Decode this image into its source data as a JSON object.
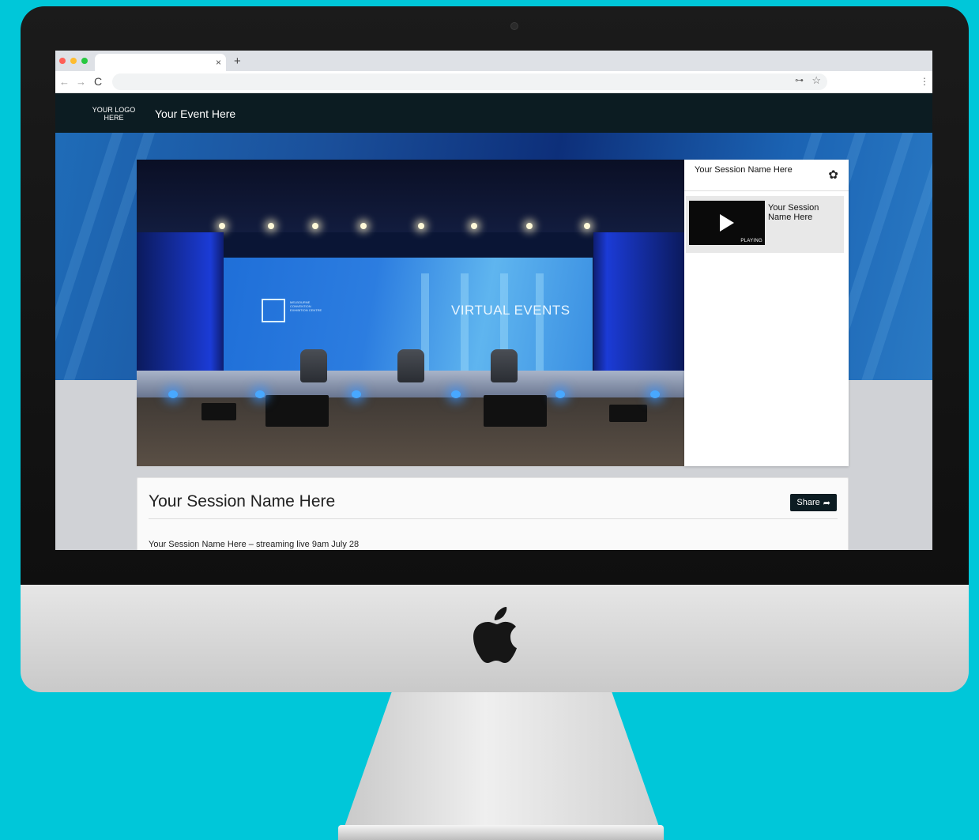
{
  "browser": {
    "tab_close": "×",
    "new_tab": "+",
    "back": "←",
    "forward": "→",
    "reload": "C",
    "key": "⊶",
    "star": "☆",
    "menu": "⋮"
  },
  "header": {
    "logo_text": "YOUR LOGO\nHERE",
    "event_title": "Your Event Here"
  },
  "video": {
    "wall_text": "VIRTUAL EVENTS",
    "venue_name": "Melbourne Convention Exhibition Centre"
  },
  "playlist": {
    "title": "Your Session Name Here",
    "gear_icon": "✿",
    "items": [
      {
        "title": "Your Session Name Here",
        "status": "PLAYING"
      }
    ]
  },
  "session": {
    "title": "Your Session Name Here",
    "share_label": "Share",
    "share_icon": "➦",
    "description": "Your Session Name Here – streaming live 9am July 28"
  },
  "colors": {
    "background": "#00c7d9",
    "header": "#0c1c22",
    "hero_blue": "#1a4f9a"
  }
}
